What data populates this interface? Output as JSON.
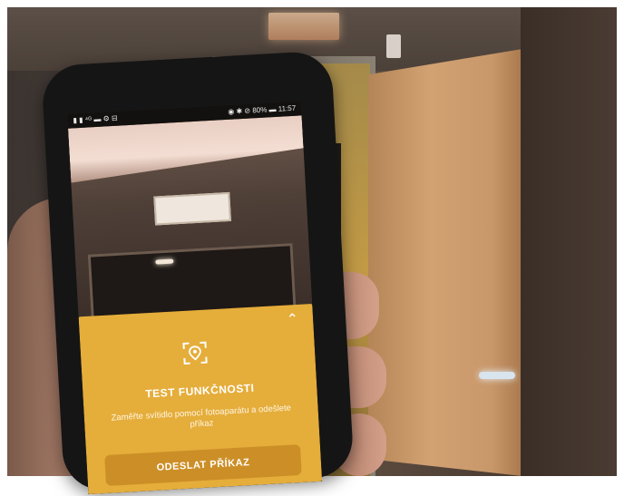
{
  "status_bar": {
    "left": "▮ ▮ ⁴ᴳ ▬ ⚙ ⊟",
    "right": "◉ ✱ ⊘ 80% ▬ 11:57"
  },
  "panel": {
    "chevron": "⌃",
    "title": "TEST FUNKČNOSTI",
    "description": "Zaměřte svítidlo pomocí fotoaparátu a odešlete příkaz",
    "send_button": "ODESLAT PŘÍKAZ",
    "icon": "camera-target-icon"
  },
  "colors": {
    "panel_bg": "#e5ad3a",
    "button_bg": "#cc8f27",
    "text": "#ffffff"
  }
}
